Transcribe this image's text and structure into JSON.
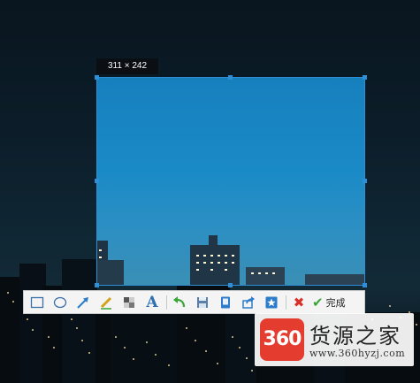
{
  "capture": {
    "size_label": "311 × 242"
  },
  "toolbar": {
    "tools": [
      {
        "id": "rectangle",
        "icon": "rectangle-icon"
      },
      {
        "id": "ellipse",
        "icon": "ellipse-icon"
      },
      {
        "id": "arrow",
        "icon": "arrow-icon"
      },
      {
        "id": "pen",
        "icon": "pen-icon"
      },
      {
        "id": "mosaic",
        "icon": "mosaic-icon"
      },
      {
        "id": "text",
        "icon": "text-icon",
        "glyph": "A"
      },
      {
        "id": "undo",
        "icon": "undo-icon"
      },
      {
        "id": "save",
        "icon": "save-icon"
      },
      {
        "id": "copy",
        "icon": "copy-icon"
      },
      {
        "id": "share",
        "icon": "share-icon"
      },
      {
        "id": "pin",
        "icon": "pin-icon"
      },
      {
        "id": "cancel",
        "icon": "cancel-icon",
        "glyph": "✖"
      },
      {
        "id": "done",
        "icon": "check-icon",
        "glyph": "✔"
      }
    ],
    "done_label": "完成"
  },
  "watermark": {
    "logo_text": "360",
    "brand_text": "货源之家",
    "site_text": "www.360hyzj.com"
  },
  "colors": {
    "accent": "#2e8fd8",
    "cancel": "#d9302b",
    "done_check": "#3aa63a",
    "logo_red": "#e43d30"
  }
}
